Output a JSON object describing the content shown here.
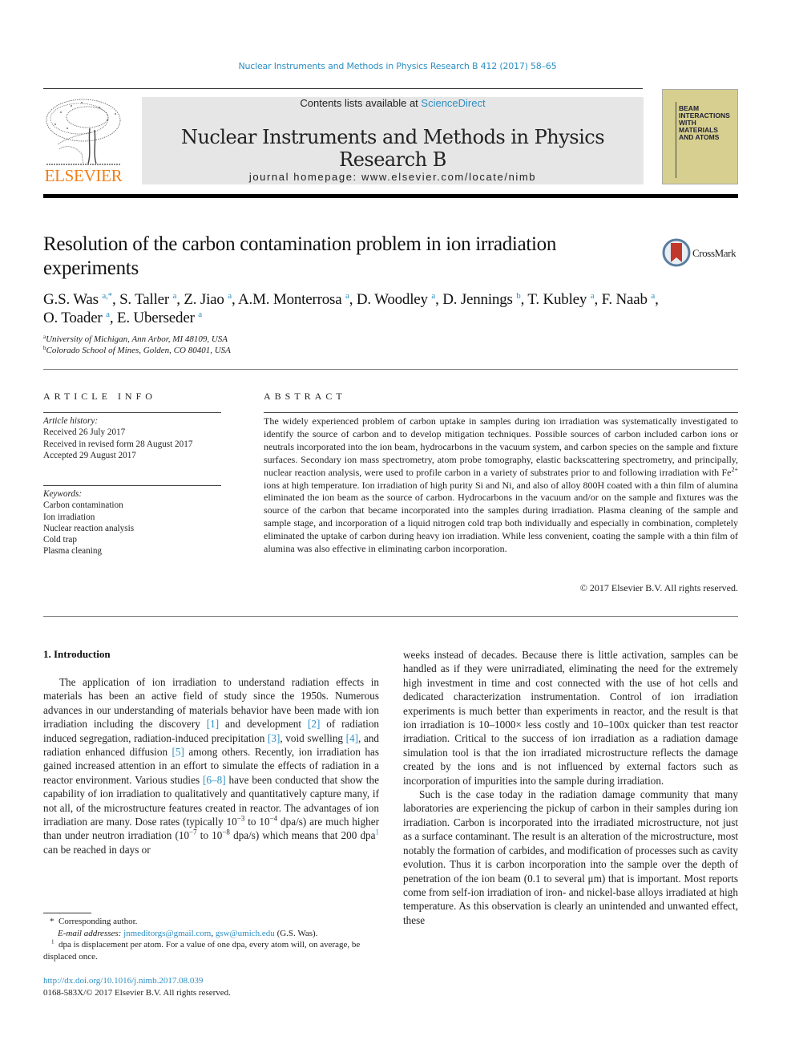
{
  "header": {
    "journal_reference": "Nuclear Instruments and Methods in Physics Research B 412 (2017) 58–65",
    "contents_prefix": "Contents lists available at ",
    "contents_link": "ScienceDirect",
    "journal_title": "Nuclear Instruments and Methods in Physics Research B",
    "homepage": "journal homepage: www.elsevier.com/locate/nimb",
    "publisher_logo_text": "ELSEVIER",
    "cover_text": [
      "BEAM",
      "INTERACTIONS",
      "WITH",
      "MATERIALS",
      "AND ATOMS"
    ]
  },
  "article": {
    "title": "Resolution of the carbon contamination problem in ion irradiation experiments",
    "crossmark_label": "CrossMark",
    "authors": [
      {
        "name": "G.S. Was",
        "sup": "a,*"
      },
      {
        "name": "S. Taller",
        "sup": "a"
      },
      {
        "name": "Z. Jiao",
        "sup": "a"
      },
      {
        "name": "A.M. Monterrosa",
        "sup": "a"
      },
      {
        "name": "D. Woodley",
        "sup": "a"
      },
      {
        "name": "D. Jennings",
        "sup": "b"
      },
      {
        "name": "T. Kubley",
        "sup": "a"
      },
      {
        "name": "F. Naab",
        "sup": "a"
      },
      {
        "name": "O. Toader",
        "sup": "a"
      },
      {
        "name": "E. Uberseder",
        "sup": "a"
      }
    ],
    "affiliations": [
      {
        "mark": "a",
        "text": "University of Michigan, Ann Arbor, MI 48109, USA"
      },
      {
        "mark": "b",
        "text": "Colorado School of Mines, Golden, CO 80401, USA"
      }
    ]
  },
  "article_info": {
    "label": "ARTICLE INFO",
    "history_heading": "Article history:",
    "history": [
      "Received 26 July 2017",
      "Received in revised form 28 August 2017",
      "Accepted 29 August 2017"
    ],
    "keywords_heading": "Keywords:",
    "keywords": [
      "Carbon contamination",
      "Ion irradiation",
      "Nuclear reaction analysis",
      "Cold trap",
      "Plasma cleaning"
    ]
  },
  "abstract": {
    "label": "ABSTRACT",
    "text_part1": "The widely experienced problem of carbon uptake in samples during ion irradiation was systematically investigated to identify the source of carbon and to develop mitigation techniques. Possible sources of carbon included carbon ions or neutrals incorporated into the ion beam, hydrocarbons in the vacuum system, and carbon species on the sample and fixture surfaces. Secondary ion mass spectrometry, atom probe tomography, elastic backscattering spectrometry, and principally, nuclear reaction analysis, were used to profile carbon in a variety of substrates prior to and following irradiation with Fe",
    "text_sup": "2+",
    "text_part2": " ions at high temperature. Ion irradiation of high purity Si and Ni, and also of alloy 800H coated with a thin film of alumina eliminated the ion beam as the source of carbon. Hydrocarbons in the vacuum and/or on the sample and fixtures was the source of the carbon that became incorporated into the samples during irradiation. Plasma cleaning of the sample and sample stage, and incorporation of a liquid nitrogen cold trap both individually and especially in combination, completely eliminated the uptake of carbon during heavy ion irradiation. While less convenient, coating the sample with a thin film of alumina was also effective in eliminating carbon incorporation.",
    "copyright": "© 2017 Elsevier B.V. All rights reserved."
  },
  "intro": {
    "heading": "1. Introduction",
    "left": {
      "s1": "The application of ion irradiation to understand radiation effects in materials has been an active field of study since the 1950s. Numerous advances in our understanding of materials behavior have been made with ion irradiation including the discovery ",
      "r1": "[1]",
      "s2": " and development ",
      "r2": "[2]",
      "s3": " of radiation induced segregation, radiation-induced precipitation ",
      "r3": "[3]",
      "s4": ", void swelling ",
      "r4": "[4]",
      "s5": ", and radiation enhanced diffusion ",
      "r5": "[5]",
      "s6": " among others. Recently, ion irradiation has gained increased attention in an effort to simulate the effects of radiation in a reactor environment. Various studies ",
      "r6": "[6–8]",
      "s7": " have been conducted that show the capability of ion irradiation to qualitatively and quantitatively capture many, if not all, of the microstructure features created in reactor. The advantages of ion irradiation are many. Dose rates (typically 10",
      "e1": "−3",
      "s8": " to 10",
      "e2": "−4",
      "s9": " dpa/s) are much higher than under neutron irradiation (10",
      "e3": "−7",
      "s10": " to 10",
      "e4": "−8",
      "s11": " dpa/s) which means that 200 dpa",
      "fn": "1",
      "s12": " can be reached in days or"
    },
    "right_p1": "weeks instead of decades. Because there is little activation, samples can be handled as if they were unirradiated, eliminating the need for the extremely high investment in time and cost connected with the use of hot cells and dedicated characterization instrumentation. Control of ion irradiation experiments is much better than experiments in reactor, and the result is that ion irradiation is 10–1000× less costly and 10–100x quicker than test reactor irradiation. Critical to the success of ion irradiation as a radiation damage simulation tool is that the ion irradiated microstructure reflects the damage created by the ions and is not influenced by external factors such as incorporation of impurities into the sample during irradiation.",
    "right_p2": "Such is the case today in the radiation damage community that many laboratories are experiencing the pickup of carbon in their samples during ion irradiation. Carbon is incorporated into the irradiated microstructure, not just as a surface contaminant. The result is an alteration of the microstructure, most notably the formation of carbides, and modification of processes such as cavity evolution. Thus it is carbon incorporation into the sample over the depth of penetration of the ion beam (0.1 to several μm) that is important. Most reports come from self-ion irradiation of iron- and nickel-base alloys irradiated at high temperature. As this observation is clearly an unintended and unwanted effect, these"
  },
  "footnotes": {
    "corresponding": "Corresponding author.",
    "corresponding_mark": "*",
    "email_label": "E-mail addresses:",
    "email1": "jnmeditorgs@gmail.com",
    "email2": "gsw@umich.edu",
    "email_suffix": " (G.S. Was).",
    "fn1_mark": "1",
    "fn1_text": "dpa is displacement per atom. For a value of one dpa, every atom will, on average, be displaced once."
  },
  "footer": {
    "doi": "http://dx.doi.org/10.1016/j.nimb.2017.08.039",
    "issn": "0168-583X/© 2017 Elsevier B.V. All rights reserved."
  },
  "colors": {
    "link": "#2e8fc2",
    "elsevier_orange": "#f07f1a",
    "banner_gray": "#e6e6e6",
    "cover_yellow": "#d6cf8f",
    "crossmark_red": "#c0392b"
  }
}
